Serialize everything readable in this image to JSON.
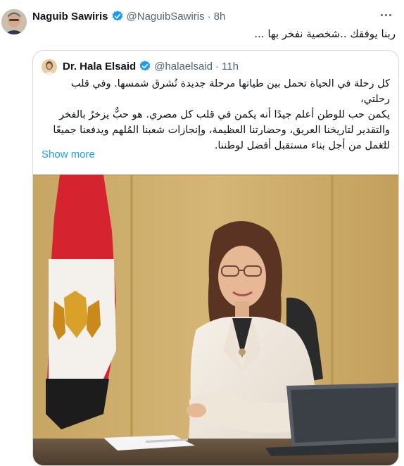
{
  "tweet": {
    "author_name": "Naguib Sawiris",
    "author_handle": "@NaguibSawiris",
    "separator": "·",
    "time": "8h",
    "text": "ربنا يوفقك ..شخصية نفخر بها ...",
    "more_icon": "more-horizontal-icon",
    "verified_color": "#1d9bf0"
  },
  "quoted": {
    "author_name": "Dr. Hala Elsaid",
    "author_handle": "@halaelsaid",
    "separator": "·",
    "time": "11h",
    "lines": [
      "كل رحلة في الحياة تحمل بين طياتها مرحلة جديدة تُشرق شمسها. وفي قلب رحلتي،",
      "يكمن حب للوطن أعلم جيدًا أنه يكمن في قلب كل مصري. هو حبٌّ يزخرُ بالفخر",
      "والتقدير لتاريخنا العريق، وحضارتنا العظيمة، وإنجازات شعبنا المُلهم ويدفعنا جميعًا",
      "للعمل من أجل بناء مستقبل أفضل لوطننا."
    ],
    "ellipsis": "...",
    "show_more": "Show more",
    "link_color": "#1d9bf0"
  }
}
